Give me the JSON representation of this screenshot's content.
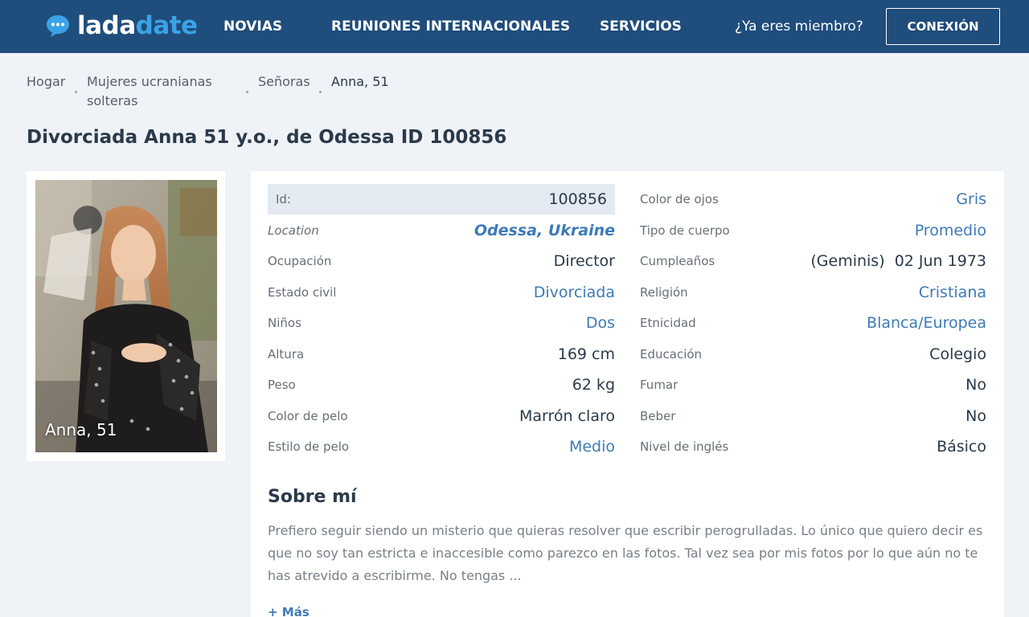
{
  "header": {
    "logo": {
      "part1": "lada",
      "part2": "date",
      "icon": "chat-bubble-icon"
    },
    "nav": [
      {
        "label": "NOVIAS"
      },
      {
        "label": "REUNIONES INTERNACIONALES"
      },
      {
        "label": "SERVICIOS"
      }
    ],
    "member_text": "¿Ya eres miembro?",
    "login_label": "CONEXIÓN"
  },
  "breadcrumb": [
    {
      "line1": "Hogar"
    },
    {
      "line1": "Mujeres ucranianas",
      "line2": "solteras"
    },
    {
      "line1": "Señoras"
    },
    {
      "line1": "Anna, 51"
    }
  ],
  "page_title": "Divorciada Anna 51 y.o., de Odessa ID 100856",
  "profile": {
    "photo_caption": "Anna, 51",
    "left_fields": [
      {
        "label": "Id:",
        "value": "100856"
      },
      {
        "label": "Location",
        "value": "Odessa, Ukraine"
      },
      {
        "label": "Ocupación",
        "value": "Director"
      },
      {
        "label": "Estado civil",
        "value": "Divorciada"
      },
      {
        "label": "Niños",
        "value": "Dos"
      },
      {
        "label": "Altura",
        "value": "169 cm"
      },
      {
        "label": "Peso",
        "value": "62 kg"
      },
      {
        "label": "Color de pelo",
        "value": "Marrón claro"
      },
      {
        "label": "Estilo de pelo",
        "value": "Medio"
      }
    ],
    "right_fields": [
      {
        "label": "Color de ojos",
        "value": "Gris"
      },
      {
        "label": "Tipo de cuerpo",
        "value": "Promedio"
      },
      {
        "label": "Cumpleaños",
        "value": "(Geminis)  02 Jun 1973"
      },
      {
        "label": "Religión",
        "value": "Cristiana"
      },
      {
        "label": "Etnicidad",
        "value": "Blanca/Europea"
      },
      {
        "label": "Educación",
        "value": "Colegio"
      },
      {
        "label": "Fumar",
        "value": "No"
      },
      {
        "label": "Beber",
        "value": "No"
      },
      {
        "label": "Nivel de inglés",
        "value": "Básico"
      }
    ]
  },
  "about": {
    "title": "Sobre mí",
    "text": "Prefiero seguir siendo un misterio que quieras resolver que escribir perogrulladas. Lo único que quiero decir es que no soy tan estricta e inaccesible como parezco en las fotos. Tal vez sea por mis fotos por lo que aún no te has atrevido a escribirme. No tengas ...",
    "more_label": "+ Más"
  },
  "colors": {
    "header_bg": "#1f4d7c",
    "accent": "#3d7ab7",
    "logo_accent": "#3aa3e6",
    "page_bg": "#eff2f7"
  }
}
